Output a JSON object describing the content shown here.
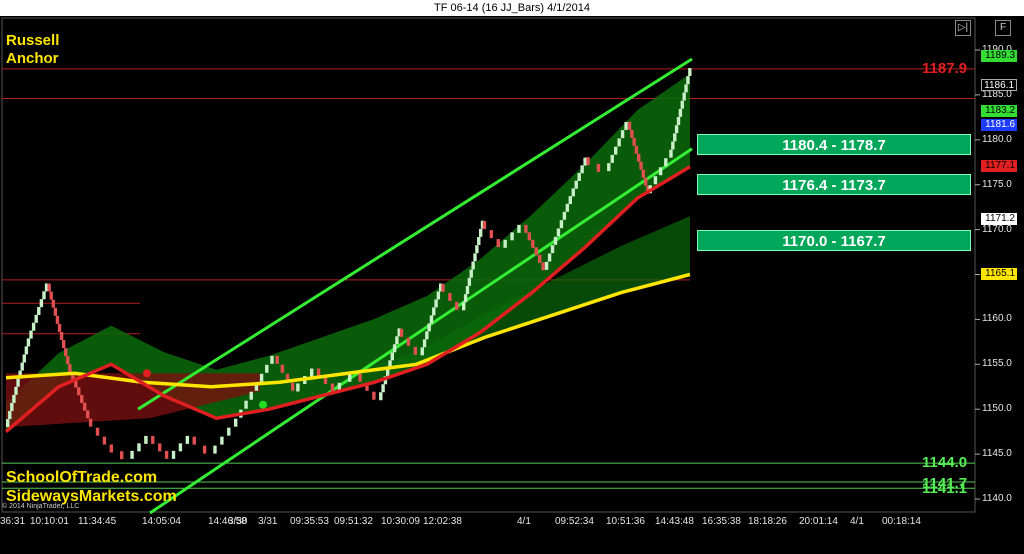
{
  "window": {
    "title": "TF 06-14 (16 JJ_Bars)  4/1/2014",
    "btn_play": "▷|",
    "btn_float": "F"
  },
  "chart_title": {
    "line1": "Russell",
    "line2": "Anchor"
  },
  "branding": {
    "line1": "SchoolOfTrade.com",
    "line2": "SidewaysMarkets.com",
    "copyright": "© 2014 NinjaTrader, LLC"
  },
  "colors": {
    "background": "#000000",
    "up_bar": "#c8f0c8",
    "down_bar": "#e05050",
    "channel": "#33ee33",
    "ema_red": "#e02020",
    "ema_yellow": "#ffe600",
    "cloud_green": "#0a6a0a",
    "cloud_red": "#7a1010",
    "zone": "#00a65a",
    "level_red": "#e02020",
    "level_green": "#55dd55"
  },
  "chart_data": {
    "type": "line",
    "title": "Russell Anchor",
    "instrument": "TF 06-14 (16 JJ_Bars)",
    "date": "4/1/2014",
    "ylim": [
      1138,
      1191
    ],
    "yticks": [
      1140.0,
      1145.0,
      1150.0,
      1155.0,
      1160.0,
      1165.0,
      1170.0,
      1175.0,
      1180.0,
      1185.0,
      1190.0
    ],
    "x_tick_labels": [
      "36:31",
      "10:10:01",
      "11:34:45",
      "14:05:04",
      "14:46:58",
      "3/30",
      "3/31",
      "09:35:53",
      "09:51:32",
      "10:30:09",
      "12:02:38",
      "4/1",
      "09:52:34",
      "10:51:36",
      "14:43:48",
      "16:35:38",
      "18:18:26",
      "20:01:14",
      "4/1",
      "00:18:14"
    ],
    "price_path": [
      1148.0,
      1157.0,
      1164.0,
      1155.0,
      1149.0,
      1146.0,
      1144.5,
      1147.0,
      1144.5,
      1147.0,
      1145.0,
      1148.0,
      1152.0,
      1156.0,
      1152.0,
      1154.5,
      1152.0,
      1154.0,
      1151.0,
      1159.0,
      1156.0,
      1164.0,
      1161.0,
      1171.0,
      1168.0,
      1170.5,
      1165.5,
      1172.0,
      1178.0,
      1176.5,
      1182.0,
      1174.0,
      1178.0,
      1188.0
    ],
    "series": [
      {
        "name": "EMA red",
        "values": [
          1147.5,
          1152.5,
          1155.0,
          1151.5,
          1149.0,
          1150.0,
          1151.5,
          1153.0,
          1155.0,
          1158.5,
          1163.0,
          1168.0,
          1173.5,
          1177.0
        ]
      },
      {
        "name": "EMA yellow",
        "values": [
          1153.5,
          1154.0,
          1153.0,
          1152.5,
          1153.0,
          1154.0,
          1155.0,
          1158.0,
          1160.5,
          1163.0,
          1165.0
        ]
      }
    ],
    "trend_channel": {
      "upper": [
        1150.0,
        1189.0
      ],
      "lower": [
        1140.0,
        1179.0
      ]
    },
    "horizontal_levels": [
      1187.9,
      1184.6,
      1164.4,
      1161.8,
      1158.4,
      1144.0,
      1141.9,
      1141.2
    ],
    "dots": [
      1154.0,
      1150.5
    ]
  },
  "price_tags": [
    {
      "label": "1189.3",
      "value": 1189.3,
      "bg": "#33dd33",
      "fg": "#000000"
    },
    {
      "label": "1186.1",
      "value": 1186.1,
      "bg": "#000000",
      "fg": "#ffffff",
      "border": "#aaaaaa"
    },
    {
      "label": "1183.2",
      "value": 1183.2,
      "bg": "#33dd33",
      "fg": "#000000"
    },
    {
      "label": "1181.6",
      "value": 1181.6,
      "bg": "#1e3cff",
      "fg": "#ffffff"
    },
    {
      "label": "1177.1",
      "value": 1177.1,
      "bg": "#e02020",
      "fg": "#000000"
    },
    {
      "label": "1171.2",
      "value": 1171.2,
      "bg": "#ffffff",
      "fg": "#000000"
    },
    {
      "label": "1165.1",
      "value": 1165.1,
      "bg": "#ffe600",
      "fg": "#000000"
    }
  ],
  "zones": [
    {
      "label": "1180.4 - 1178.7",
      "value": 1179.55
    },
    {
      "label": "1176.4 - 1173.7",
      "value": 1175.05
    },
    {
      "label": "1170.0 - 1167.7",
      "value": 1168.85
    }
  ],
  "level_labels": [
    {
      "label": "1187.9",
      "value": 1187.9,
      "color": "#e02020"
    },
    {
      "label": "1144.0",
      "value": 1144.0,
      "color": "#55ee55"
    },
    {
      "label": "1141.7",
      "value": 1141.7,
      "color": "#55ee55"
    },
    {
      "label": "1141.1",
      "value": 1141.1,
      "color": "#55ee55"
    }
  ]
}
